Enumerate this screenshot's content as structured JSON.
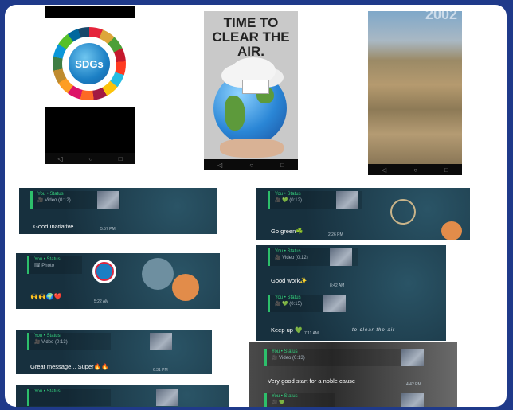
{
  "poster": {
    "title": "TIME TO CLEAR THE AIR."
  },
  "sdg_logo": {
    "label": "SDGs"
  },
  "aerial": {
    "year": "2002"
  },
  "nav_glyphs": {
    "back": "◁",
    "home": "○",
    "recent": "□"
  },
  "status_sender": "You • Status",
  "left_cards": [
    {
      "media": "🎥 Video (0:12)",
      "message": "Good Inatiative",
      "time": "5:57 PM"
    },
    {
      "media": "🖼 Photo",
      "message": "🙌🙌🌍❤️",
      "time": "5:22 AM"
    },
    {
      "media": "🎥 Video (0:13)",
      "message": "Great message... Super🔥🔥",
      "time": "6:31 PM"
    },
    {
      "media": "",
      "message": "",
      "time": ""
    }
  ],
  "right_cards": [
    {
      "media": "🎥 💚 (0:12)",
      "message": "Go green☘️",
      "time": "2:26 PM"
    },
    {
      "media": "🎥 Video (0:12)",
      "message": "Good work✨",
      "time": "8:42 AM"
    },
    {
      "media": "🎥 💚 (0:15)",
      "message": "Keep up 💚",
      "time": "7:11 AM"
    },
    {
      "media": "🎥 Video (0:13)",
      "message": "Very good start for a noble cause",
      "time": "4:42 PM"
    },
    {
      "media": "🎥 💚",
      "message": "",
      "time": ""
    }
  ],
  "handwriting": "to clear the air",
  "colors": {
    "border": "#1f3a8a",
    "card_bg": "#1d3a4a",
    "status_green": "#35d07f"
  }
}
